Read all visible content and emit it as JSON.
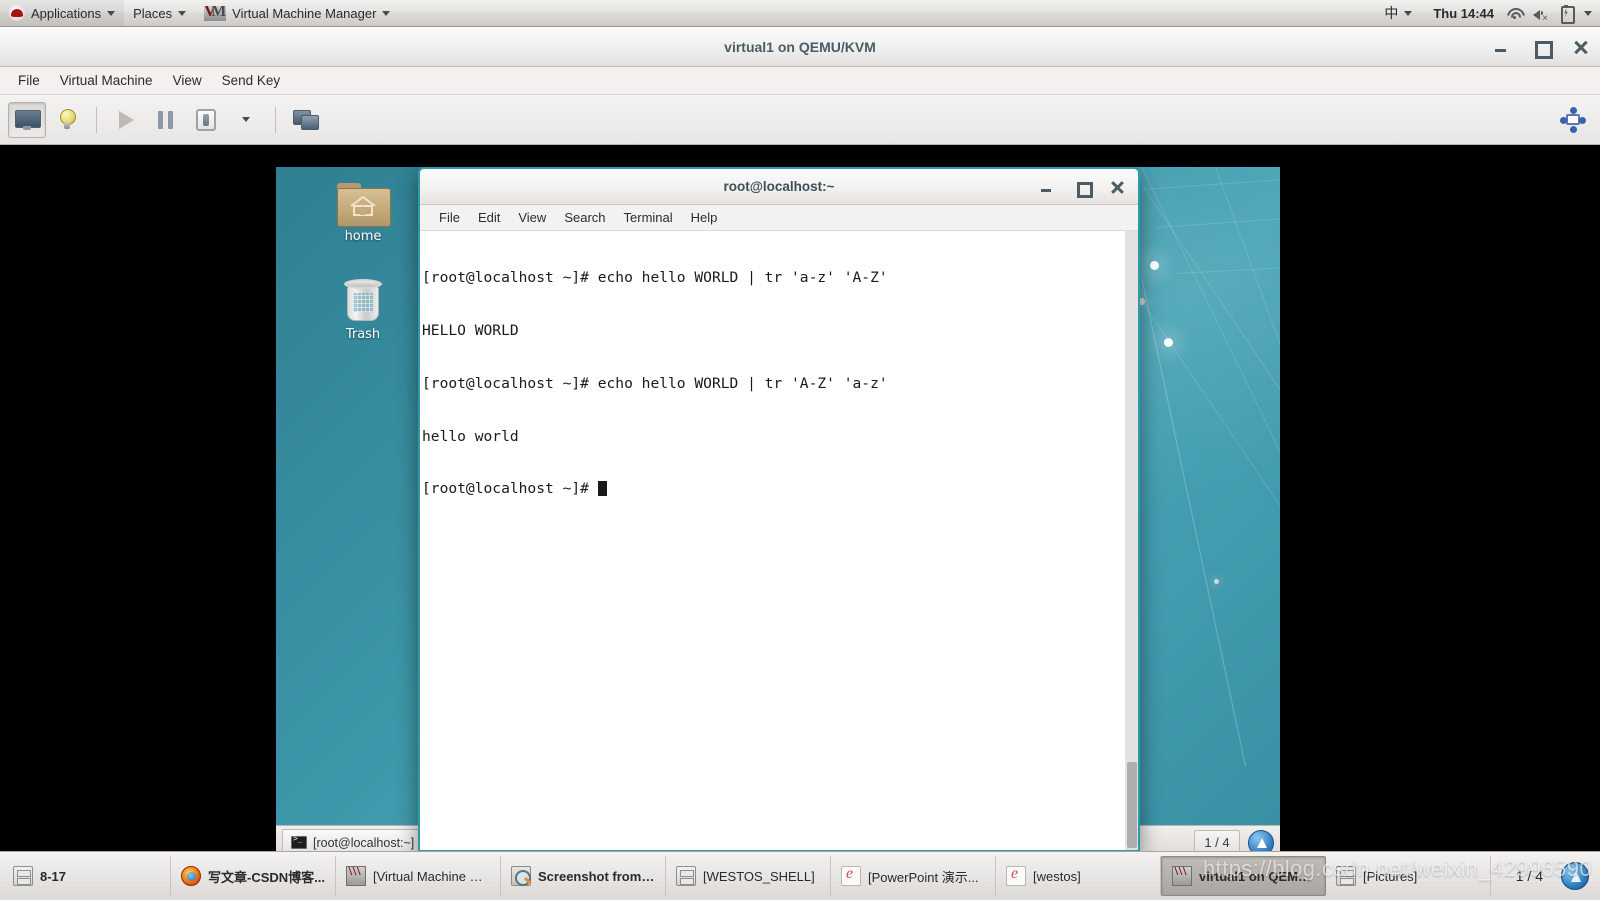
{
  "gnome_panel": {
    "logo_icon": "redhat-logo-icon",
    "menus": [
      {
        "label": "Applications",
        "icon": "redhat-logo-icon"
      },
      {
        "label": "Places",
        "icon": null
      },
      {
        "label": "Virtual Machine Manager",
        "icon": "vmm-logo-icon"
      }
    ],
    "ime_label": "中",
    "clock": "Thu 14:44",
    "status_icons": [
      "wifi-icon",
      "volume-muted-icon",
      "battery-charging-icon"
    ]
  },
  "vmm_window": {
    "title": "virtual1 on QEMU/KVM",
    "window_buttons": {
      "minimize": "minimize-icon",
      "maximize": "maximize-icon",
      "close": "close-icon"
    },
    "menubar": [
      "File",
      "Virtual Machine",
      "View",
      "Send Key"
    ],
    "toolbar": [
      {
        "name": "show-console-button",
        "icon": "monitor-icon",
        "state": "pressed"
      },
      {
        "name": "show-details-button",
        "icon": "lightbulb-icon",
        "state": "normal"
      },
      {
        "name": "run-button",
        "icon": "play-icon",
        "state": "disabled"
      },
      {
        "name": "pause-button",
        "icon": "pause-icon",
        "state": "normal"
      },
      {
        "name": "shutdown-button",
        "icon": "shutdown-icon",
        "state": "normal"
      },
      {
        "name": "shutdown-options-button",
        "icon": "chevron-down-icon",
        "state": "normal"
      },
      {
        "name": "fullscreen-button",
        "icon": "multi-monitor-icon",
        "state": "normal"
      }
    ],
    "toolbar_right": {
      "name": "resize-to-vm-button",
      "icon": "resize-arrows-icon"
    }
  },
  "vm_desktop": {
    "icons": [
      {
        "label": "home",
        "icon": "home-folder-icon"
      },
      {
        "label": "Trash",
        "icon": "trash-can-icon"
      }
    ],
    "taskbar": {
      "items": [
        {
          "label": "[root@localhost:~]",
          "icon": "terminal-icon",
          "active": false
        },
        {
          "label": "[root@localhost:~]",
          "icon": "terminal-icon",
          "active": true
        }
      ],
      "pager": "1 / 4"
    }
  },
  "terminal": {
    "title": "root@localhost:~",
    "window_buttons": {
      "minimize": "minimize-icon",
      "maximize": "maximize-icon",
      "close": "close-icon"
    },
    "menubar": [
      "File",
      "Edit",
      "View",
      "Search",
      "Terminal",
      "Help"
    ],
    "lines": [
      "[root@localhost ~]# echo hello WORLD | tr 'a-z' 'A-Z'",
      "HELLO WORLD",
      "[root@localhost ~]# echo hello WORLD | tr 'A-Z' 'a-z'",
      "hello world"
    ],
    "prompt": "[root@localhost ~]# "
  },
  "host_taskbar": {
    "items": [
      {
        "label": "8-17",
        "icon": "file-cabinet-icon",
        "active": false,
        "bold": true
      },
      {
        "label": "写文章-CSDN博客...",
        "icon": "firefox-icon",
        "active": false,
        "bold": true
      },
      {
        "label": "[Virtual Machine M...",
        "icon": "vmm-logo-icon",
        "active": false,
        "bold": false
      },
      {
        "label": "Screenshot from 2...",
        "icon": "screenshot-icon",
        "active": false,
        "bold": true
      },
      {
        "label": "[WESTOS_SHELL]",
        "icon": "file-cabinet-icon",
        "active": false,
        "bold": false
      },
      {
        "label": "[PowerPoint 演示...",
        "icon": "document-icon",
        "active": false,
        "bold": false
      },
      {
        "label": "[westos]",
        "icon": "document-icon",
        "active": false,
        "bold": false
      },
      {
        "label": "virtual1 on QEMU...",
        "icon": "vmm-logo-icon",
        "active": true,
        "bold": true
      },
      {
        "label": "[Pictures]",
        "icon": "file-cabinet-icon",
        "active": false,
        "bold": false
      }
    ],
    "pager": "1 / 4",
    "arrow_icon": "workspace-switch-icon"
  },
  "watermark": {
    "text": "https://blog.csdn.net/weixin_42996590"
  },
  "colors": {
    "vm_wallpaper_teal": "#3c94a7",
    "terminal_border_teal": "#2e9aa8",
    "panel_grey": "#e4e2e0",
    "title_text": "#4b5c64"
  }
}
